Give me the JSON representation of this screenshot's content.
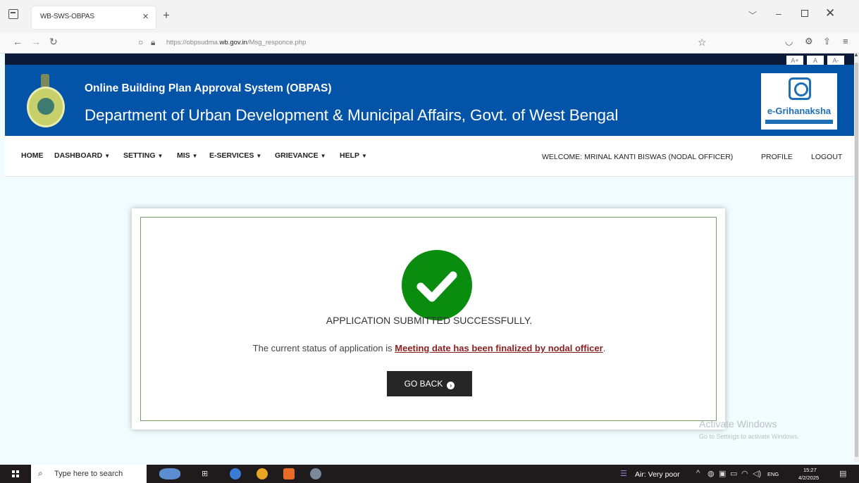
{
  "browser": {
    "tab_title": "WB-SWS-OBPAS",
    "tab_close": "×",
    "new_tab": "+",
    "url_prefix": "https://obpsudma.",
    "url_domain": "wb.gov.in",
    "url_path": "/Msg_responce.php"
  },
  "header": {
    "title": "Online Building Plan Approval System (OBPAS)",
    "subtitle": "Department of Urban Development & Municipal Affairs, Govt. of West Bengal",
    "logo_text": "e-Grihanaksha",
    "font_buttons": [
      "A+",
      "A",
      "A-"
    ]
  },
  "menu": {
    "items": [
      {
        "label": "HOME",
        "caret": false
      },
      {
        "label": "DASHBOARD",
        "caret": true
      },
      {
        "label": "SETTING",
        "caret": true
      },
      {
        "label": "MIS",
        "caret": true
      },
      {
        "label": "E-SERVICES",
        "caret": true
      },
      {
        "label": "GRIEVANCE",
        "caret": true
      },
      {
        "label": "HELP",
        "caret": true
      }
    ],
    "welcome": "WELCOME: MRINAL KANTI BISWAS (NODAL OFFICER)",
    "profile": "PROFILE",
    "logout": "LOGOUT"
  },
  "result": {
    "message": "APPLICATION SUBMITTED SUCCESSFULLY.",
    "status_prefix": "The current status of application is ",
    "status_value": "Meeting date has been finalized by nodal officer",
    "status_suffix": ".",
    "button": "GO BACK"
  },
  "watermark": {
    "line1": "Activate Windows",
    "line2": "Go to Settings to activate Windows."
  },
  "taskbar": {
    "search_placeholder": "Type here to search",
    "air_quality": "Air: Very poor",
    "lang": "ENG",
    "time": "15:27",
    "date": "4/2/2025"
  },
  "colors": {
    "header_blue": "#0353a8",
    "success_green": "#0a8c0f",
    "status_red": "#8a1f1f"
  }
}
